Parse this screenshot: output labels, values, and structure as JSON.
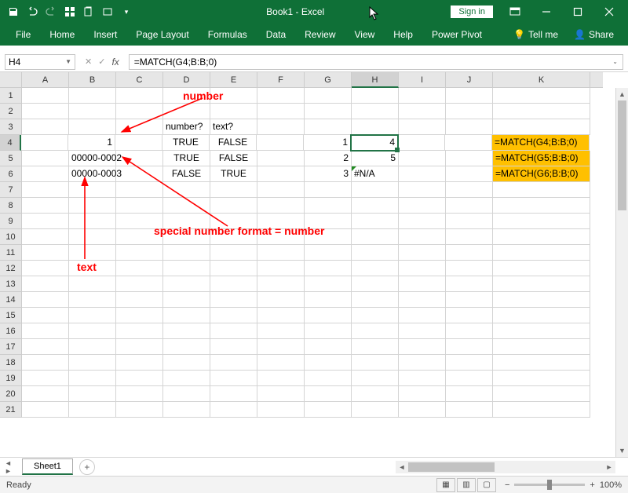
{
  "title_bar": {
    "document_title": "Book1 - Excel",
    "sign_in": "Sign in"
  },
  "ribbon": {
    "tabs": [
      "File",
      "Home",
      "Insert",
      "Page Layout",
      "Formulas",
      "Data",
      "Review",
      "View",
      "Help",
      "Power Pivot"
    ],
    "tell_me": "Tell me",
    "share": "Share"
  },
  "formula_bar": {
    "name_box": "H4",
    "formula": "=MATCH(G4;B:B;0)"
  },
  "columns": [
    "A",
    "B",
    "C",
    "D",
    "E",
    "F",
    "G",
    "H",
    "I",
    "J",
    "K"
  ],
  "selected_cell": {
    "col": "H",
    "row": 4
  },
  "cells": {
    "B4": {
      "value": "1",
      "align": "r"
    },
    "B5": {
      "value": "00000-0002",
      "align": "r"
    },
    "B6": {
      "value": "00000-0003",
      "align": "l"
    },
    "D3": {
      "value": "number?",
      "align": "l"
    },
    "E3": {
      "value": "text?",
      "align": "l"
    },
    "D4": {
      "value": "TRUE",
      "align": "c"
    },
    "E4": {
      "value": "FALSE",
      "align": "c"
    },
    "D5": {
      "value": "TRUE",
      "align": "c"
    },
    "E5": {
      "value": "FALSE",
      "align": "c"
    },
    "D6": {
      "value": "FALSE",
      "align": "c"
    },
    "E6": {
      "value": "TRUE",
      "align": "c"
    },
    "G4": {
      "value": "1",
      "align": "r"
    },
    "G5": {
      "value": "2",
      "align": "r"
    },
    "G6": {
      "value": "3",
      "align": "r"
    },
    "H4": {
      "value": "4",
      "align": "r"
    },
    "H5": {
      "value": "5",
      "align": "r"
    },
    "H6": {
      "value": "#N/A",
      "align": "l",
      "error": true
    },
    "K4": {
      "value": "  =MATCH(G4;B:B;0)",
      "align": "l",
      "fill": "yellow"
    },
    "K5": {
      "value": "  =MATCH(G5;B:B;0)",
      "align": "l",
      "fill": "yellow"
    },
    "K6": {
      "value": "  =MATCH(G6;B:B;0)",
      "align": "l",
      "fill": "yellow"
    }
  },
  "annotations": {
    "number": "number",
    "special": "special number format = number",
    "text": "text"
  },
  "sheet_tab": "Sheet1",
  "status": {
    "ready": "Ready",
    "zoom": "100%"
  },
  "chart_data": null
}
